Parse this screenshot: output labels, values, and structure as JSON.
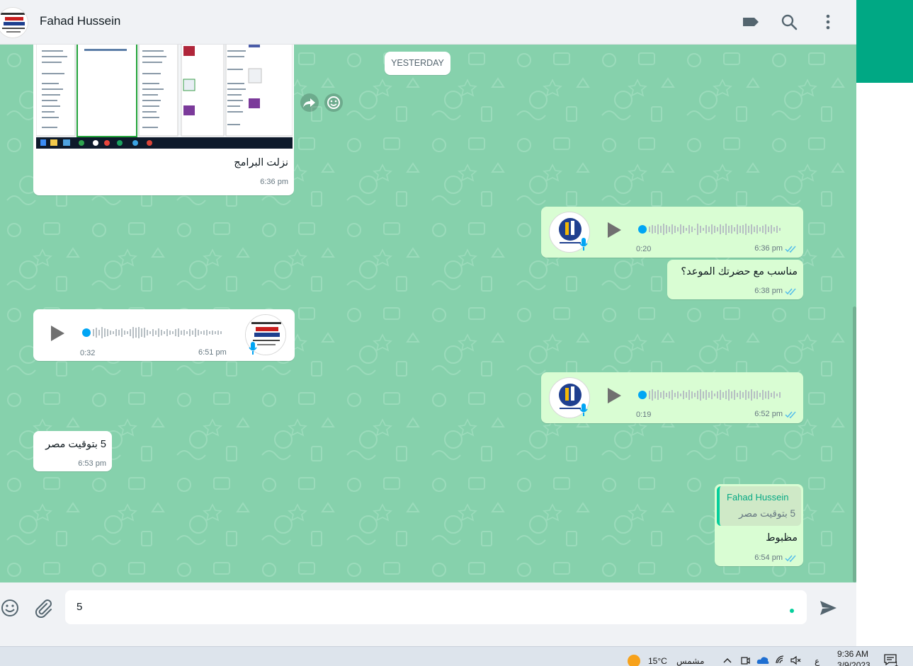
{
  "header": {
    "contact_name": "Fahad Hussein",
    "avatar_lines": [
      "اللهم إني أسألك",
      "من فضلك",
      "ورحمتك",
      "فإنه لا يملكها إلا أنت"
    ]
  },
  "chat": {
    "date_separator": "YESTERDAY",
    "messages": [
      {
        "id": "m1",
        "direction": "in",
        "type": "image",
        "caption": "نزلت البرامج",
        "time": "6:36 pm"
      },
      {
        "id": "m2",
        "direction": "out",
        "type": "voice",
        "duration": "0:20",
        "time": "6:36 pm",
        "read": true
      },
      {
        "id": "m3",
        "direction": "out",
        "type": "text",
        "text": "مناسب مع حضرتك الموعد؟",
        "time": "6:38 pm",
        "read": true
      },
      {
        "id": "m4",
        "direction": "in",
        "type": "voice",
        "duration": "0:32",
        "time": "6:51 pm"
      },
      {
        "id": "m5",
        "direction": "out",
        "type": "voice",
        "duration": "0:19",
        "time": "6:52 pm",
        "read": true
      },
      {
        "id": "m6",
        "direction": "in",
        "type": "text",
        "text": "5 بتوقيت مصر",
        "time": "6:53 pm"
      },
      {
        "id": "m7",
        "direction": "out",
        "type": "reply",
        "quoted_author": "Fahad Hussein",
        "quoted_text": "5 بتوقيت مصر",
        "text": "مظبوط",
        "time": "6:54 pm",
        "read": true
      }
    ],
    "voice_avatar_label": [
      "RADIANCE",
      "GROUP"
    ]
  },
  "composer": {
    "value": "5"
  },
  "taskbar": {
    "weather_temp": "15°C",
    "weather_text": "مشمس",
    "language": "ع",
    "clock_time": "9:36 AM",
    "clock_date": "3/9/2023",
    "notification_count": "1"
  },
  "colors": {
    "chat_background": "#86d1ac",
    "outgoing_bubble": "#d9fdd3",
    "incoming_bubble": "#ffffff",
    "accent": "#00a884",
    "read_ticks": "#53bdeb"
  }
}
